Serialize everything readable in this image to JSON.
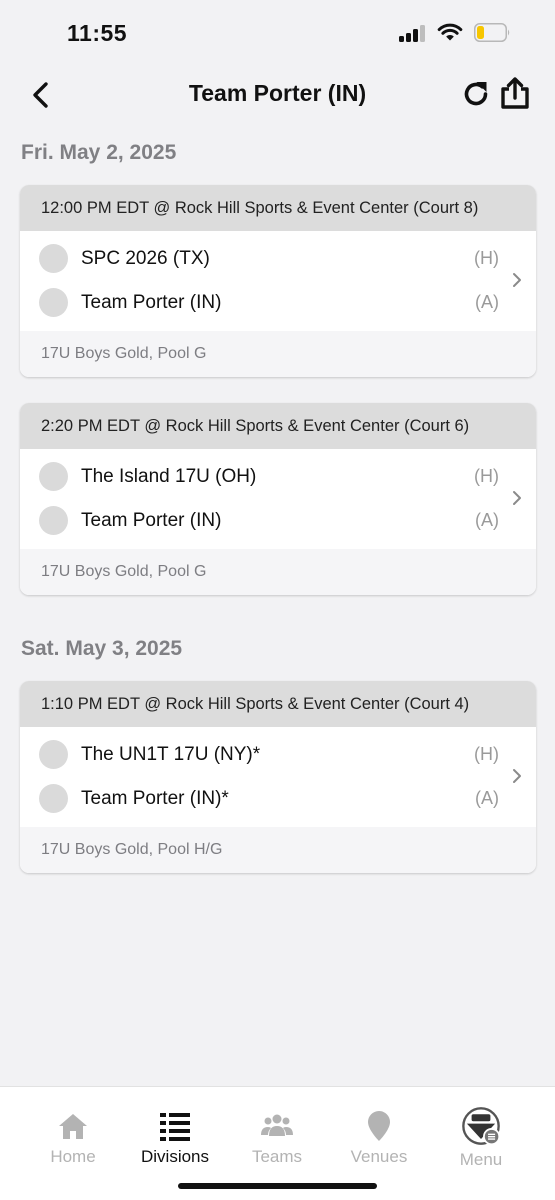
{
  "status_bar": {
    "time": "11:55"
  },
  "header": {
    "title": "Team Porter (IN)"
  },
  "days": [
    {
      "date": "Fri. May 2, 2025",
      "games": [
        {
          "time_location": "12:00 PM EDT @ Rock Hill Sports & Event Center (Court 8)",
          "home_team": "SPC 2026 (TX)",
          "home_marker": "(H)",
          "away_team": "Team Porter (IN)",
          "away_marker": "(A)",
          "division": "17U Boys Gold, Pool G"
        },
        {
          "time_location": "2:20 PM EDT @ Rock Hill Sports & Event Center (Court 6)",
          "home_team": "The Island 17U (OH)",
          "home_marker": "(H)",
          "away_team": "Team Porter (IN)",
          "away_marker": "(A)",
          "division": "17U Boys Gold, Pool G"
        }
      ]
    },
    {
      "date": "Sat. May 3, 2025",
      "games": [
        {
          "time_location": "1:10 PM EDT @ Rock Hill Sports & Event Center (Court 4)",
          "home_team": "The UN1T 17U (NY)*",
          "home_marker": "(H)",
          "away_team": "Team Porter (IN)*",
          "away_marker": "(A)",
          "division": "17U Boys Gold, Pool H/G"
        }
      ]
    }
  ],
  "tab_bar": {
    "active": "Divisions",
    "tabs": [
      {
        "label": "Home",
        "icon": "home-icon"
      },
      {
        "label": "Divisions",
        "icon": "list-icon"
      },
      {
        "label": "Teams",
        "icon": "people-icon"
      },
      {
        "label": "Venues",
        "icon": "location-pin-icon"
      },
      {
        "label": "Menu",
        "icon": "gold-logo-icon"
      }
    ]
  },
  "colors": {
    "background": "#f2f2f4",
    "card_header": "#dcdcdc",
    "inactive_tab": "#b3b3b3",
    "active_tab": "#111111",
    "battery_level": "#f7c600"
  },
  "battery_level": 0.25
}
